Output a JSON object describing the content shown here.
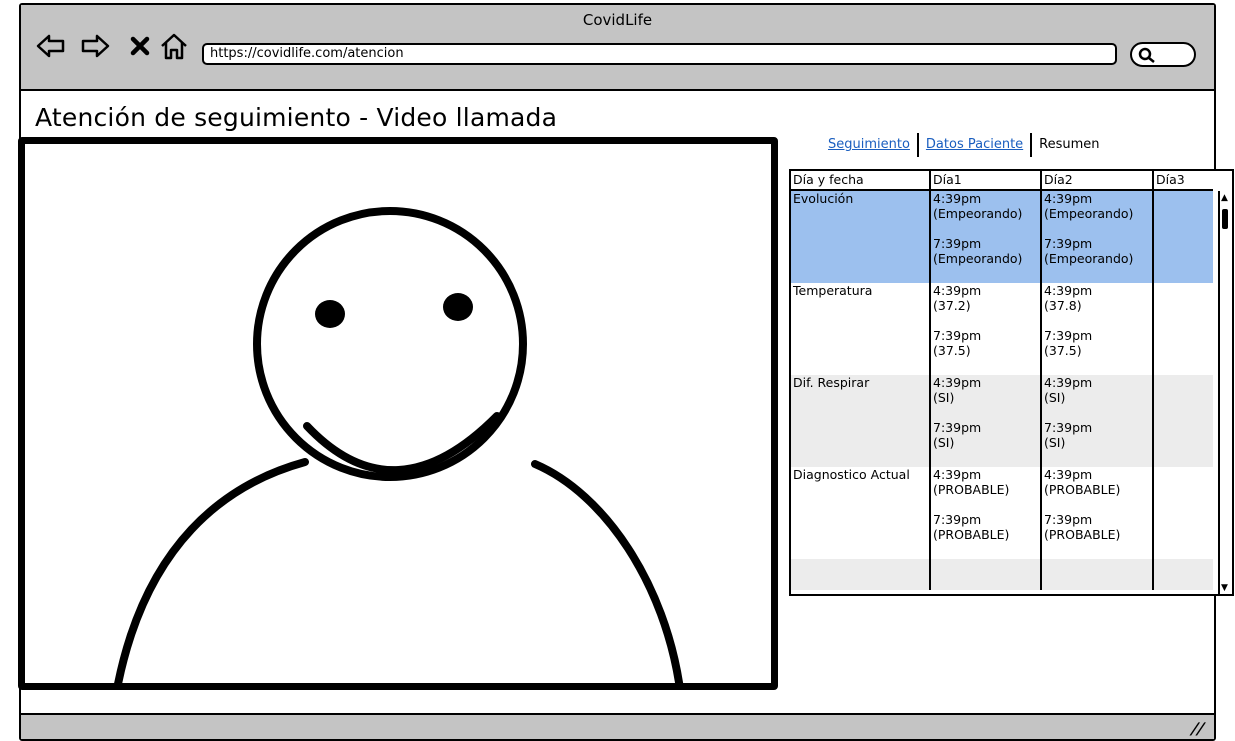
{
  "window": {
    "title": "CovidLife"
  },
  "browser": {
    "url": "https://covidlife.com/atencion",
    "nav_icons": [
      "back-arrow-icon",
      "forward-arrow-icon",
      "close-icon",
      "home-icon"
    ],
    "search_icon": "search-icon"
  },
  "page": {
    "heading": "Atención de seguimiento - Video llamada"
  },
  "video": {
    "placeholder_icon": "person-avatar-icon"
  },
  "tabs": [
    {
      "label": "Seguimiento",
      "type": "link"
    },
    {
      "label": "Datos Paciente",
      "type": "link"
    },
    {
      "label": "Resumen",
      "type": "plain"
    }
  ],
  "grid": {
    "columns": [
      "Día y fecha",
      "Día1",
      "Día2",
      "Día3"
    ],
    "rows": [
      {
        "label": "Evolución",
        "dia1": "4:39pm\n(Empeorando)\n\n7:39pm\n(Empeorando)",
        "dia2": "4:39pm\n(Empeorando)\n\n7:39pm\n(Empeorando)",
        "dia3": ""
      },
      {
        "label": "Temperatura",
        "dia1": "4:39pm\n(37.2)\n\n7:39pm\n(37.5)",
        "dia2": "4:39pm\n(37.8)\n\n7:39pm\n(37.5)",
        "dia3": ""
      },
      {
        "label": "Dif. Respirar",
        "dia1": "4:39pm\n(SI)\n\n7:39pm\n(SI)",
        "dia2": "4:39pm\n(SI)\n\n7:39pm\n(SI)",
        "dia3": ""
      },
      {
        "label": "Diagnostico Actual",
        "dia1": "4:39pm\n(PROBABLE)\n\n7:39pm\n(PROBABLE)",
        "dia2": "4:39pm\n(PROBABLE)\n\n7:39pm\n(PROBABLE)",
        "dia3": ""
      }
    ],
    "selected_row_color": "#9cc0ee",
    "alt_row_color": "#ececec"
  },
  "colors": {
    "chrome": "#c4c4c4",
    "link": "#1a5ebf"
  }
}
